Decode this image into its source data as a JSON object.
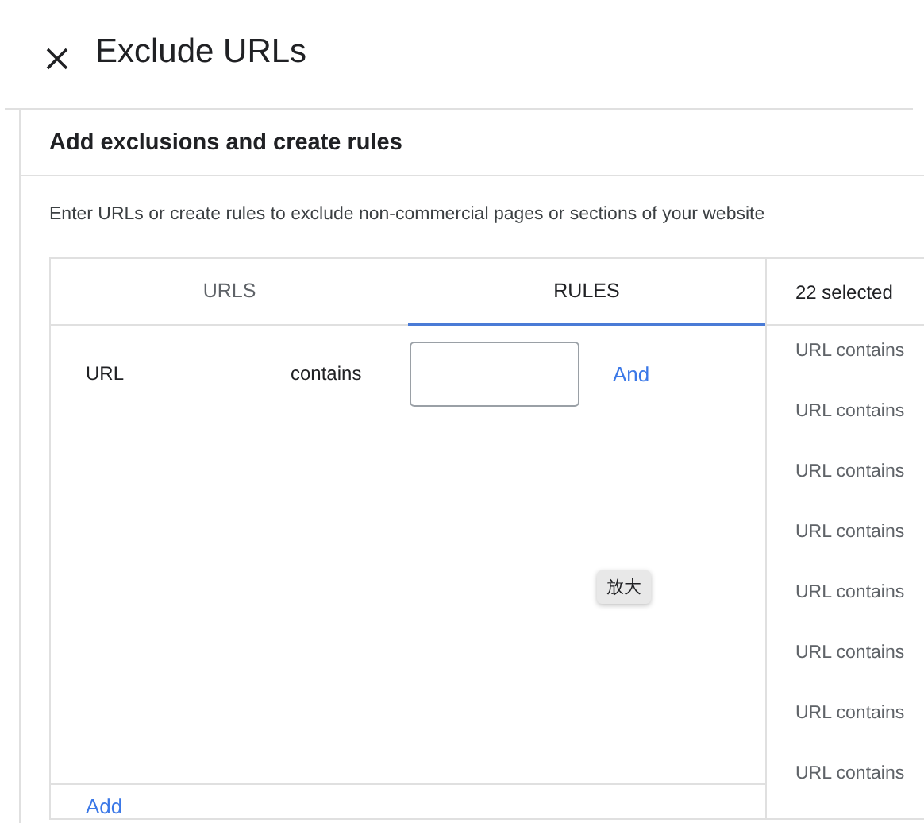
{
  "dialog": {
    "title": "Exclude URLs"
  },
  "section": {
    "heading": "Add exclusions and create rules",
    "description": "Enter URLs or create rules to exclude non-commercial pages or sections of your website"
  },
  "tabs": [
    {
      "label": "URLS",
      "selected": false
    },
    {
      "label": "RULES",
      "selected": true
    }
  ],
  "rule": {
    "field": "URL",
    "operator": "contains",
    "connector": "And"
  },
  "add_link": "Add",
  "selected_panel": {
    "count": "22 selected",
    "items": [
      "URL contains",
      "URL contains",
      "URL contains",
      "URL contains",
      "URL contains",
      "URL contains",
      "URL contains",
      "URL contains"
    ]
  },
  "tooltip": "放大"
}
